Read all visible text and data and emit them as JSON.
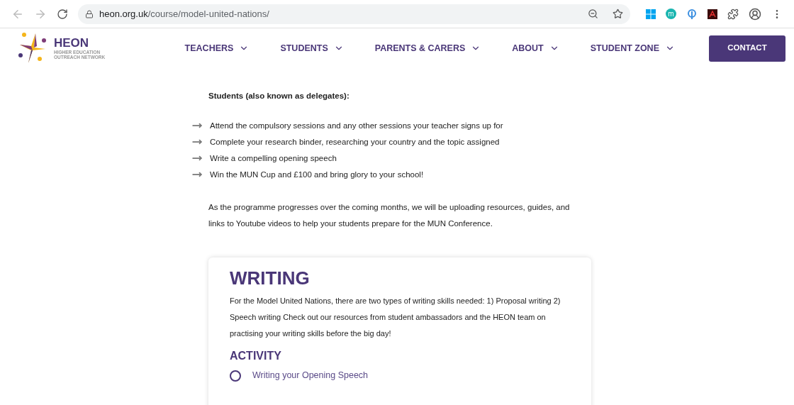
{
  "browser": {
    "url_host": "heon.org.uk",
    "url_path": "/course/model-united-nations/",
    "extension_letter": "m"
  },
  "header": {
    "logo_title": "HEON",
    "logo_line_1": "HIGHER EDUCATION",
    "logo_line_2": "OUTREACH NETWORK",
    "nav": [
      {
        "label": "TEACHERS"
      },
      {
        "label": "STUDENTS"
      },
      {
        "label": "PARENTS & CARERS"
      },
      {
        "label": "ABOUT"
      },
      {
        "label": "STUDENT ZONE"
      }
    ],
    "contact": "CONTACT"
  },
  "content": {
    "heading": "Students (also known as delegates):",
    "bullets": [
      "Attend the compulsory sessions and any other sessions your teacher signs up for",
      "Complete your research binder, researching your country and the topic assigned",
      "Write a compelling opening speech",
      "Win the MUN Cup and £100 and bring glory to your school!"
    ],
    "paragraph": "As the programme progresses over the coming months, we will be uploading resources, guides, and links to Youtube videos to help your students prepare for the MUN Conference."
  },
  "card": {
    "title": "WRITING",
    "text": "For the Model United Nations, there are two types of writing skills needed: 1) Proposal writing 2) Speech writing Check out our resources from student ambassadors and the HEON team on practising your writing skills before the big day!",
    "activity_title": "ACTIVITY",
    "activities": [
      {
        "label": "Writing your Opening Speech",
        "checked": false
      }
    ]
  }
}
